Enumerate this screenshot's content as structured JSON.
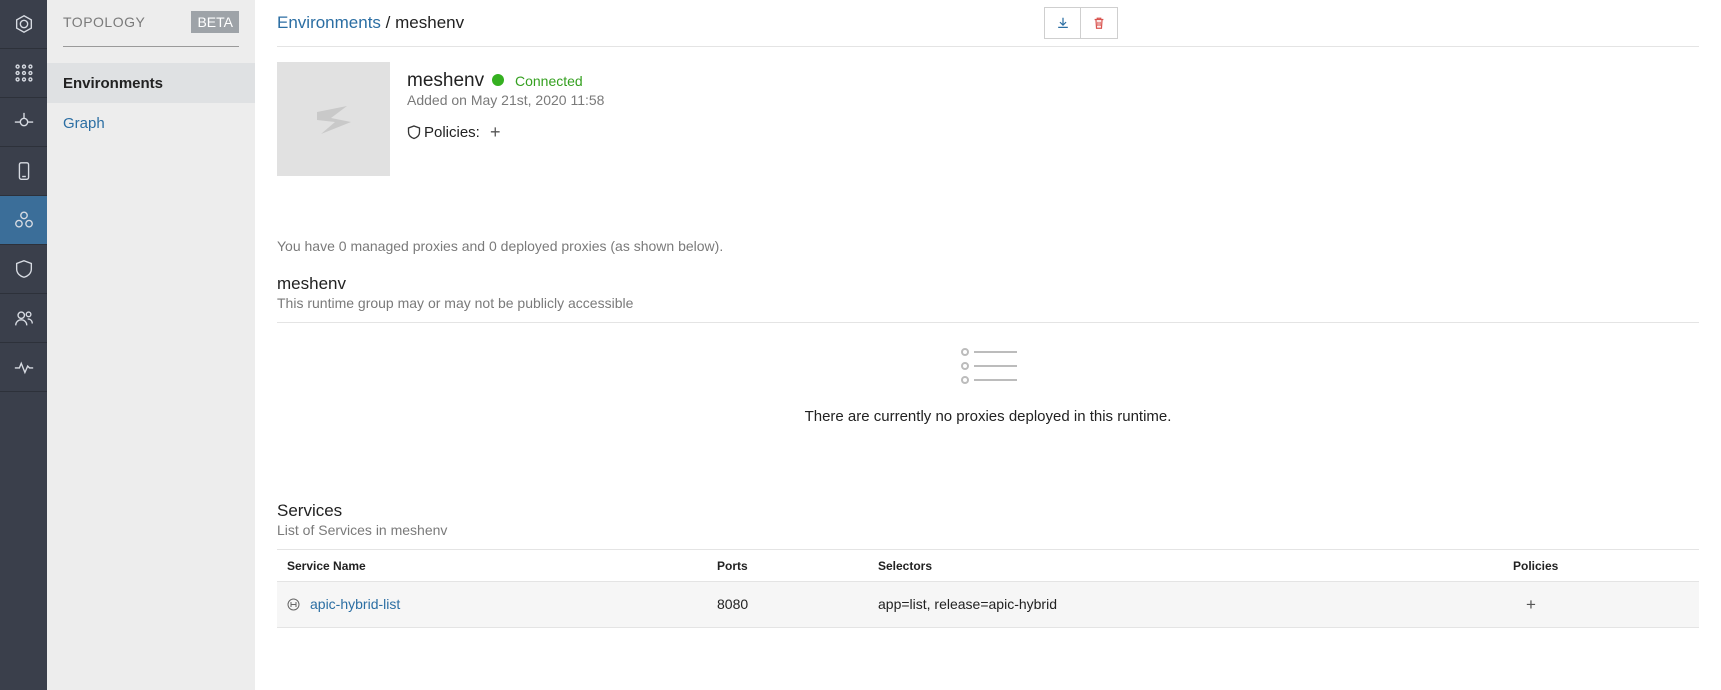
{
  "rail": {
    "items": [
      {
        "icon": "logo-icon",
        "active": false
      },
      {
        "icon": "apps-grid-icon",
        "active": false
      },
      {
        "icon": "api-icon",
        "active": false
      },
      {
        "icon": "mobile-device-icon",
        "active": false
      },
      {
        "icon": "topology-icon",
        "active": true
      },
      {
        "icon": "shield-icon",
        "active": false
      },
      {
        "icon": "users-icon",
        "active": false
      },
      {
        "icon": "analytics-pulse-icon",
        "active": false
      }
    ]
  },
  "subnav": {
    "title": "TOPOLOGY",
    "badge": "BETA",
    "items": [
      {
        "label": "Environments",
        "active": true
      },
      {
        "label": "Graph",
        "active": false
      }
    ]
  },
  "breadcrumb": {
    "parent": "Environments",
    "separator": "/",
    "current": "meshenv"
  },
  "toolbar": {
    "download_icon": "download-icon",
    "delete_icon": "trash-icon"
  },
  "environment": {
    "name": "meshenv",
    "status": "Connected",
    "status_color": "#35b020",
    "added_on": "Added on May 21st, 2020 11:58",
    "policies_label": "Policies:",
    "policies_add": "+"
  },
  "proxy_summary": "You have 0 managed proxies and 0 deployed proxies (as shown below).",
  "runtime": {
    "title": "meshenv",
    "subtitle": "This runtime group may or may not be publicly accessible",
    "empty_message": "There are currently no proxies deployed in this runtime."
  },
  "services": {
    "title": "Services",
    "subtitle": "List of Services in meshenv",
    "columns": [
      "Service Name",
      "Ports",
      "Selectors",
      "Policies"
    ],
    "rows": [
      {
        "name": "apic-hybrid-list",
        "ports": "8080",
        "selectors": "app=list, release=apic-hybrid",
        "policies_add": "+"
      }
    ]
  },
  "colors": {
    "accent": "#2b6ea3",
    "rail_bg": "#3a3f4b",
    "rail_active": "#3b6e99",
    "delete": "#d9534f"
  }
}
